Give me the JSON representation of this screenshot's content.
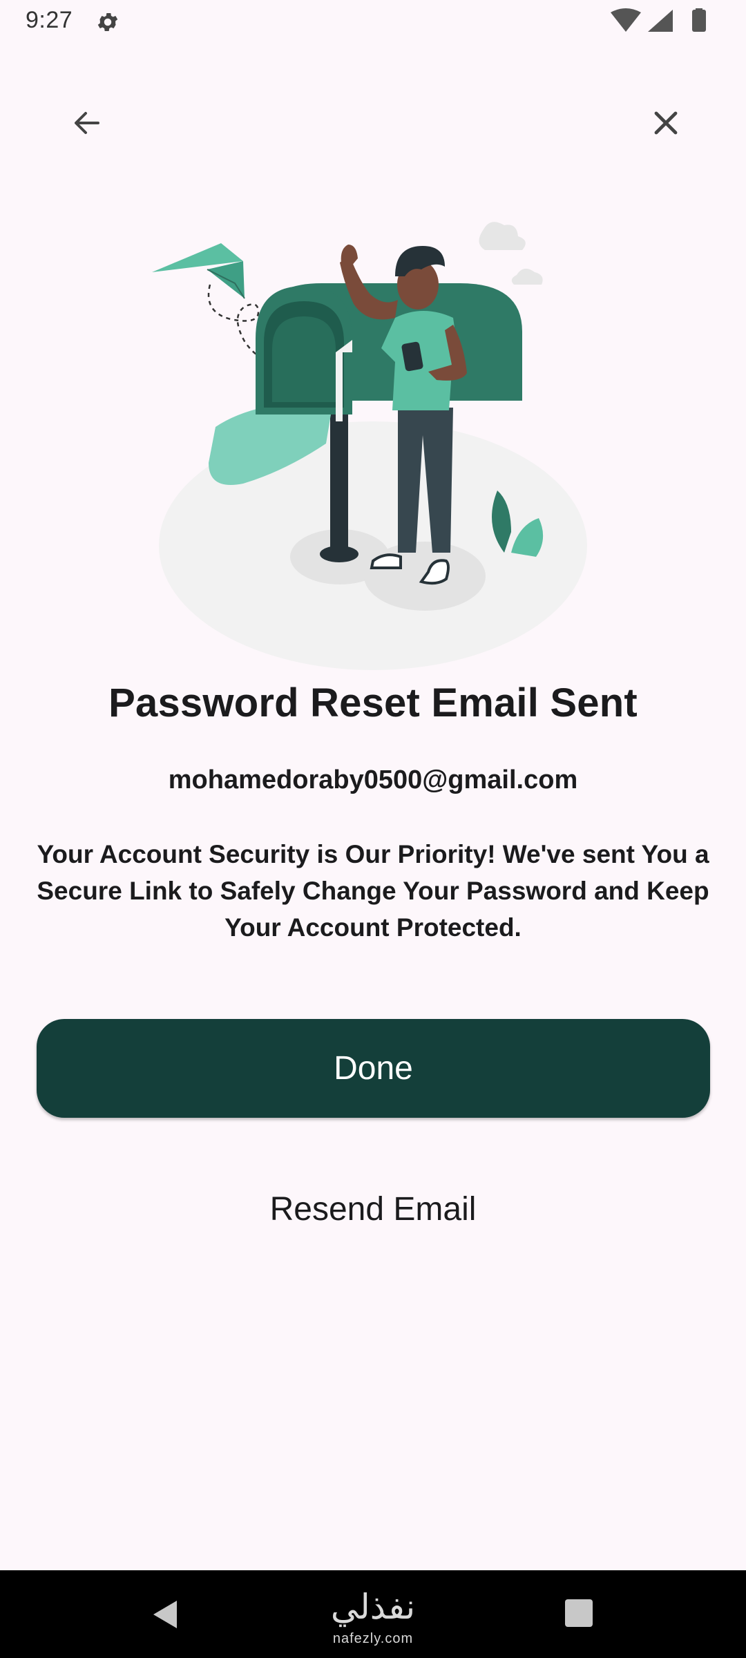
{
  "status_bar": {
    "time": "9:27",
    "icons": [
      "settings-icon",
      "wifi-icon",
      "signal-icon",
      "battery-icon"
    ]
  },
  "top_bar": {
    "back_icon": "arrow-left-icon",
    "close_icon": "close-icon"
  },
  "content": {
    "title": "Password Reset Email Sent",
    "email": "mohamedoraby0500@gmail.com",
    "description": "Your Account Security is Our Priority! We've sent You a Secure Link to Safely Change Your Password and Keep Your Account Protected.",
    "done_label": "Done",
    "resend_label": "Resend Email"
  },
  "nav_bar": {
    "watermark_logo": "نفذلي",
    "watermark_text": "nafezly.com"
  },
  "colors": {
    "background": "#fdf7fb",
    "primary_button": "#143f3a",
    "accent_green": "#5bbfa2",
    "dark_green": "#2f6f5e"
  }
}
